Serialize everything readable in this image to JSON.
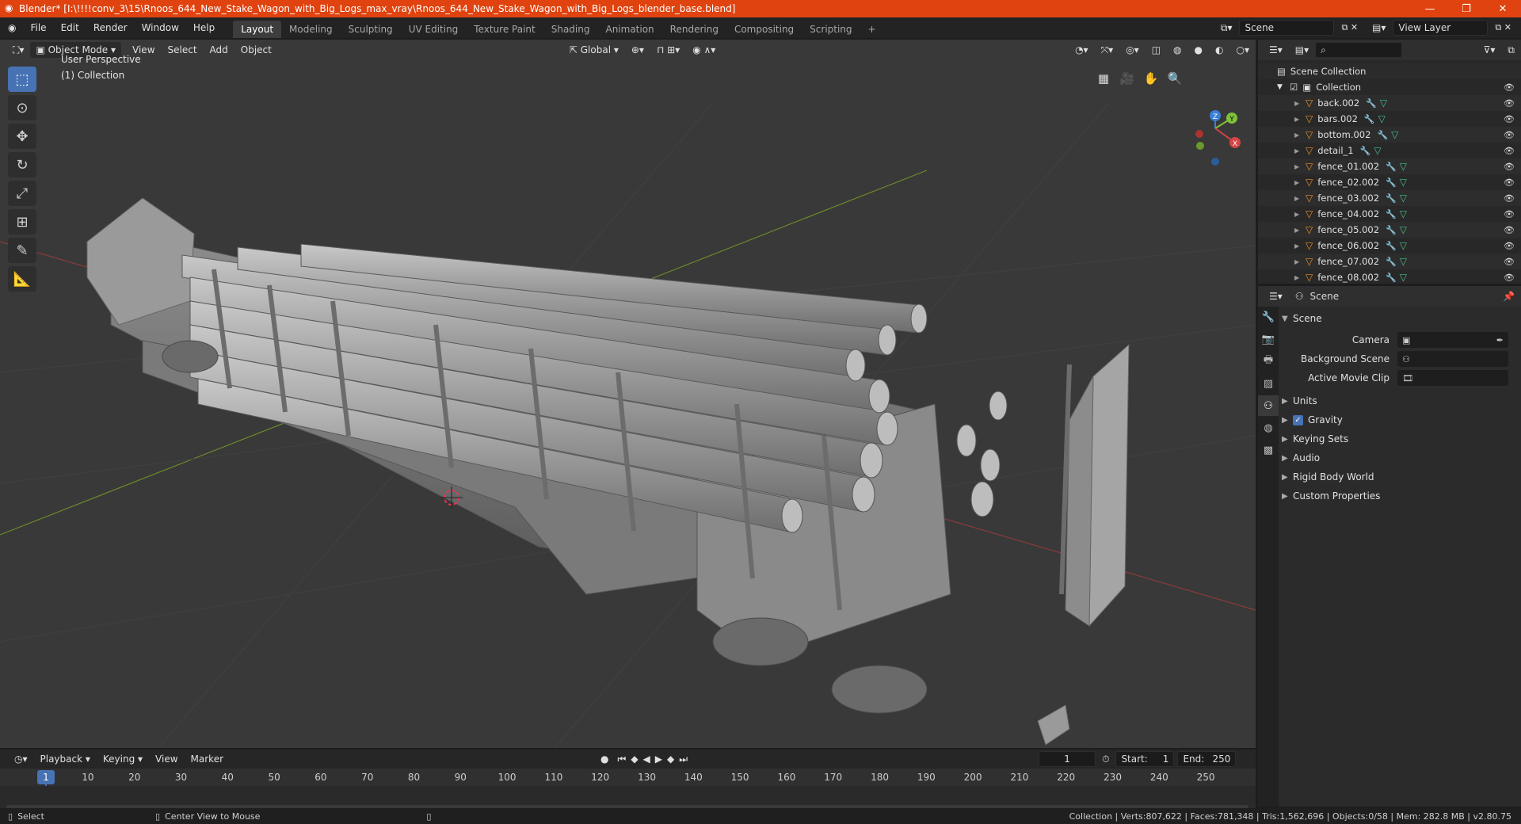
{
  "titlebar": {
    "title": "Blender* [I:\\!!!!conv_3\\15\\Rnoos_644_New_Stake_Wagon_with_Big_Logs_max_vray\\Rnoos_644_New_Stake_Wagon_with_Big_Logs_blender_base.blend]",
    "minimize": "—",
    "maximize": "❐",
    "close": "✕"
  },
  "menu": [
    "File",
    "Edit",
    "Render",
    "Window",
    "Help"
  ],
  "workspaces": [
    "Layout",
    "Modeling",
    "Sculpting",
    "UV Editing",
    "Texture Paint",
    "Shading",
    "Animation",
    "Rendering",
    "Compositing",
    "Scripting"
  ],
  "add_workspace": "+",
  "scene_field": "Scene",
  "view_layer_field": "View Layer",
  "viewport": {
    "mode": "Object Mode",
    "menus": [
      "View",
      "Select",
      "Add",
      "Object"
    ],
    "orientation": "Global",
    "perspective_label": "User Perspective",
    "collection_label": "(1) Collection",
    "gizmo_axes": {
      "x": "X",
      "y": "Y",
      "z": "Z"
    }
  },
  "timeline": {
    "menus": [
      "Playback",
      "Keying",
      "View",
      "Marker"
    ],
    "current_frame": "1",
    "start_label": "Start:",
    "start": "1",
    "end_label": "End:",
    "end": "250",
    "ruler": [
      "1",
      "10",
      "20",
      "30",
      "40",
      "50",
      "60",
      "70",
      "80",
      "90",
      "100",
      "110",
      "120",
      "130",
      "140",
      "150",
      "160",
      "170",
      "180",
      "190",
      "200",
      "210",
      "220",
      "230",
      "240",
      "250"
    ]
  },
  "statusbar": {
    "select": "Select",
    "center_view": "Center View to Mouse",
    "stats": "Collection | Verts:807,622 | Faces:781,348 | Tris:1,562,696 | Objects:0/58 | Mem: 282.8 MB | v2.80.75"
  },
  "outliner": {
    "scene_collection": "Scene Collection",
    "collection": "Collection",
    "items": [
      "back.002",
      "bars.002",
      "bottom.002",
      "detail_1",
      "fence_01.002",
      "fence_02.002",
      "fence_03.002",
      "fence_04.002",
      "fence_05.002",
      "fence_06.002",
      "fence_07.002",
      "fence_08.002"
    ]
  },
  "properties": {
    "context": "Scene",
    "panel": "Scene",
    "camera_label": "Camera",
    "background_scene_label": "Background Scene",
    "active_movie_clip_label": "Active Movie Clip",
    "subpanels": [
      "Units",
      "Gravity",
      "Keying Sets",
      "Audio",
      "Rigid Body World",
      "Custom Properties"
    ]
  }
}
